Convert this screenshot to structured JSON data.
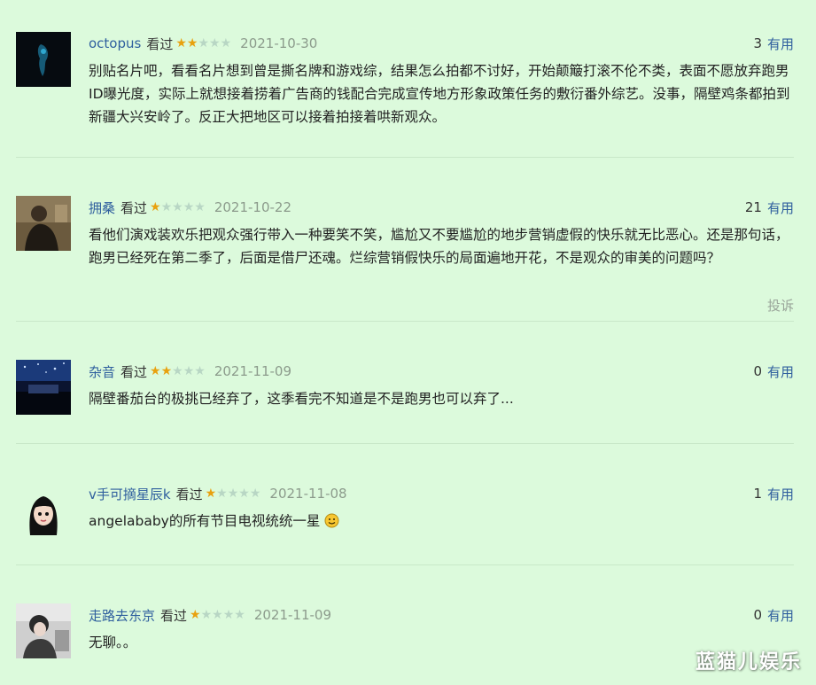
{
  "reviews": [
    {
      "user": "octopus",
      "status": "看过",
      "rating": 2,
      "date": "2021-10-30",
      "useful_count": "3",
      "useful_label": "有用",
      "text": "别贴名片吧，看看名片想到曾是撕名牌和游戏综，结果怎么拍都不讨好，开始颠簸打滚不伦不类，表面不愿放弃跑男ID曝光度，实际上就想接着捞着广告商的钱配合完成宣传地方形象政策任务的敷衍番外综艺。没事，隔壁鸡条都拍到新疆大兴安岭了。反正大把地区可以接着拍接着哄新观众。"
    },
    {
      "user": "拥桑",
      "status": "看过",
      "rating": 1,
      "date": "2021-10-22",
      "useful_count": "21",
      "useful_label": "有用",
      "text": "看他们演戏装欢乐把观众强行带入一种要笑不笑，尴尬又不要尴尬的地步营销虚假的快乐就无比恶心。还是那句话，跑男已经死在第二季了，后面是借尸还魂。烂综营销假快乐的局面遍地开花，不是观众的审美的问题吗？",
      "report_label": "投诉"
    },
    {
      "user": "杂音",
      "status": "看过",
      "rating": 2,
      "date": "2021-11-09",
      "useful_count": "0",
      "useful_label": "有用",
      "text": "隔壁番茄台的极挑已经弃了，这季看完不知道是不是跑男也可以弃了..."
    },
    {
      "user": "v手可摘星辰k",
      "status": "看过",
      "rating": 1,
      "date": "2021-11-08",
      "useful_count": "1",
      "useful_label": "有用",
      "text": "angelababy的所有节目电视统统一星"
    },
    {
      "user": "走路去东京",
      "status": "看过",
      "rating": 1,
      "date": "2021-11-09",
      "useful_count": "0",
      "useful_label": "有用",
      "text": "无聊。。"
    }
  ],
  "watermark": "蓝猫儿娱乐",
  "colors": {
    "background": "#dcfadc",
    "link": "#2f5f9e",
    "star_on": "#e8a10f",
    "star_off": "#b8d6c4"
  }
}
